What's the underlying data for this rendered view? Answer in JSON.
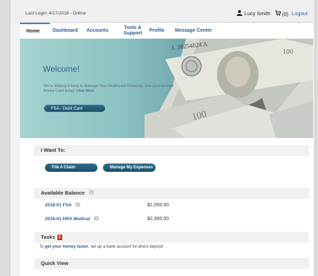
{
  "header": {
    "last_login": "Last Login: 4/17/2018 - Online",
    "user_name": "Lucy Smith",
    "cart_count": "(0)",
    "logout": "Logout"
  },
  "nav": {
    "items": [
      {
        "label": "Home"
      },
      {
        "label": "Dashboard"
      },
      {
        "label": "Accounts"
      },
      {
        "label": "Tools & Support"
      },
      {
        "label": "Profile"
      },
      {
        "label": "Message Center"
      }
    ]
  },
  "hero": {
    "welcome": "Welcome!",
    "text": "We're Making it Easy to Manage Your Healthcare Finances. Use your no-cost Benny Card today!",
    "link": "View More",
    "button": "FSA - Debit Card"
  },
  "i_want_to": {
    "title": "I Want To:",
    "buttons": [
      "File A Claim",
      "Manage My Expenses"
    ]
  },
  "balance": {
    "title": "Available Balance",
    "rows": [
      {
        "name": "2018-01 FSA",
        "amount": "$1,000.00"
      },
      {
        "name": "2018-01 HRA Medical",
        "amount": "$2,300.00"
      }
    ]
  },
  "tasks": {
    "title": "Tasks",
    "badge": "1",
    "prefix": "To ",
    "link": "get your money faster",
    "suffix": ", set up a bank account for direct deposit"
  },
  "quick_view": {
    "title": "Quick View"
  },
  "colors": {
    "brand_blue": "#2b5d91",
    "button_teal": "#1d4d66",
    "alert_red": "#c0392b"
  }
}
